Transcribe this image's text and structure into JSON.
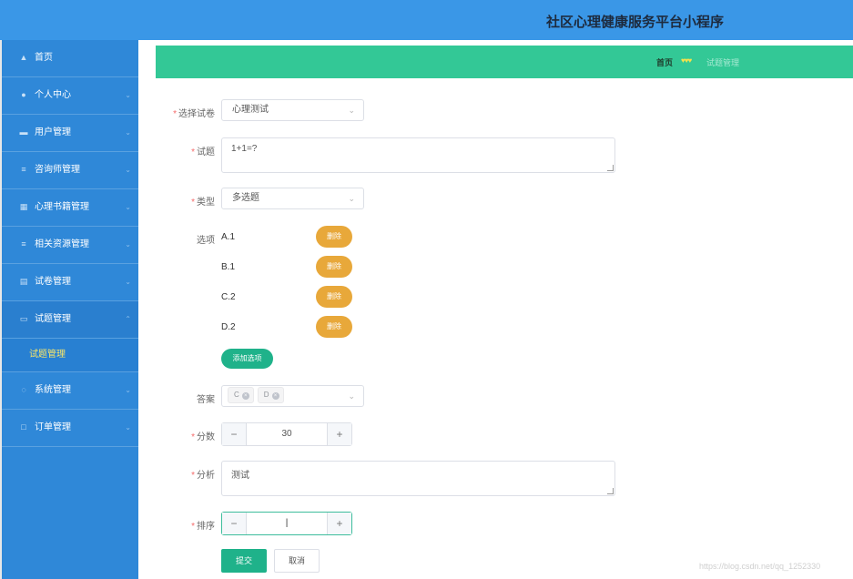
{
  "app": {
    "title": "社区心理健康服务平台小程序"
  },
  "sidebar": {
    "items": [
      {
        "label": "首页",
        "icon": "home-icon",
        "glyph": "▲"
      },
      {
        "label": "个人中心",
        "icon": "user-icon",
        "glyph": "●"
      },
      {
        "label": "用户管理",
        "icon": "users-icon",
        "glyph": "▬"
      },
      {
        "label": "咨询师管理",
        "icon": "list-icon",
        "glyph": "≡"
      },
      {
        "label": "心理书籍管理",
        "icon": "grid-icon",
        "glyph": "▦"
      },
      {
        "label": "相关资源管理",
        "icon": "list-icon",
        "glyph": "≡"
      },
      {
        "label": "试卷管理",
        "icon": "clipboard-icon",
        "glyph": "▤"
      },
      {
        "label": "试题管理",
        "icon": "message-icon",
        "glyph": "▭"
      },
      {
        "label": "系统管理",
        "icon": "bulb-icon",
        "glyph": "◌"
      },
      {
        "label": "订单管理",
        "icon": "square-icon",
        "glyph": "□"
      }
    ],
    "submenu": {
      "label": "试题管理"
    }
  },
  "breadcrumb": {
    "home": "首页",
    "separator": "♥♥♥",
    "current": "试题管理"
  },
  "form": {
    "paper": {
      "label": "选择试卷",
      "value": "心理测试"
    },
    "question": {
      "label": "试题",
      "value": "1+1=?"
    },
    "type": {
      "label": "类型",
      "value": "多选题"
    },
    "options": {
      "label": "选项",
      "items": [
        "A.1",
        "B.1",
        "C.2",
        "D.2"
      ],
      "delete_label": "删除",
      "add_label": "添加选项"
    },
    "answer": {
      "label": "答案",
      "tags": [
        "C",
        "D"
      ]
    },
    "score": {
      "label": "分数",
      "value": "30",
      "minus": "−",
      "plus": "+"
    },
    "analysis": {
      "label": "分析",
      "value": "测试"
    },
    "order": {
      "label": "排序",
      "value": "",
      "minus": "−",
      "plus": "+"
    },
    "submit_label": "提交",
    "cancel_label": "取消"
  },
  "watermark": "https://blog.csdn.net/qq_1252330",
  "colors": {
    "header": "#3a97e7",
    "sidebar": "#2f88d8",
    "breadcrumb": "#33c896",
    "primary": "#1fb28a",
    "delete": "#e8a83a",
    "submenu_text": "#f6e56a"
  }
}
